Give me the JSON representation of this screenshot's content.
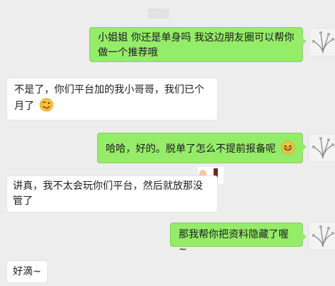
{
  "chat": {
    "messages": [
      {
        "side": "right",
        "text": "小姐姐 你还是单身吗  我这边朋友圈可以帮你做一个推荐哦"
      },
      {
        "side": "left",
        "text": "不是了，你们平台加的我小哥哥，我们已个月了",
        "emoji": "wink-tongue-emoji"
      },
      {
        "side": "right",
        "text": "哈哈，好的。脱单了怎么不提前报备呢",
        "emoji": "grin-emoji"
      },
      {
        "side": "left",
        "text": "讲真，我不太会玩你们平台，然后就放那没管了"
      },
      {
        "side": "right",
        "text": "那我帮你把资料隐藏了喔~"
      },
      {
        "side": "left",
        "text": "好滴~"
      }
    ]
  },
  "colors": {
    "background": "#ededed",
    "self_bubble": "#95ec69",
    "other_bubble": "#ffffff"
  }
}
